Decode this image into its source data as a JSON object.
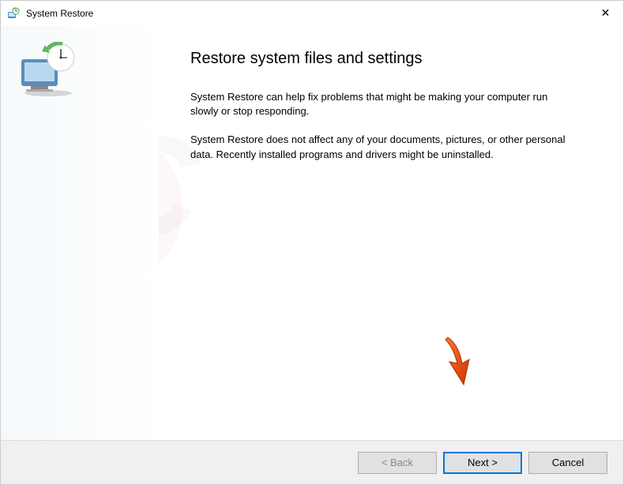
{
  "titlebar": {
    "title": "System Restore",
    "close_label": "✕"
  },
  "content": {
    "heading": "Restore system files and settings",
    "para1": "System Restore can help fix problems that might be making your computer run slowly or stop responding.",
    "para2": "System Restore does not affect any of your documents, pictures, or other personal data. Recently installed programs and drivers might be uninstalled."
  },
  "buttons": {
    "back": "< Back",
    "next": "Next >",
    "cancel": "Cancel"
  }
}
